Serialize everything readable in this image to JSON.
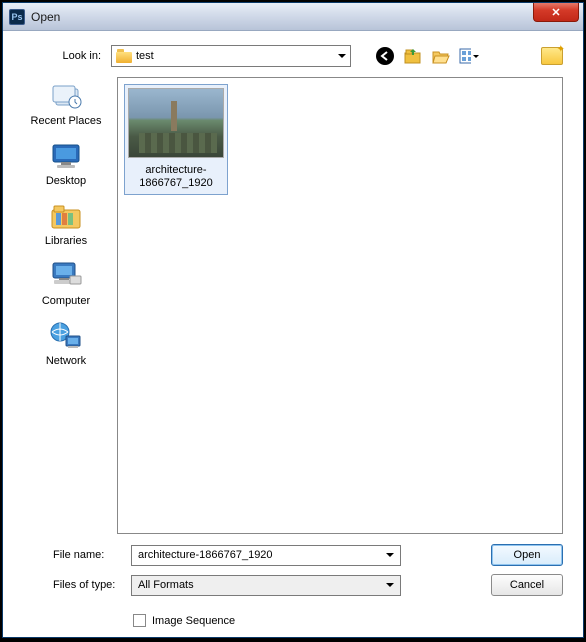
{
  "window": {
    "title": "Open",
    "close_glyph": "✕"
  },
  "lookin": {
    "label": "Look in:",
    "value": "test"
  },
  "toolbar": {
    "back": "back-icon",
    "up": "up-icon",
    "recent": "recent-icon",
    "view": "view-icon",
    "newfolder": "new-folder-icon"
  },
  "places": [
    {
      "key": "recent",
      "label": "Recent Places"
    },
    {
      "key": "desktop",
      "label": "Desktop"
    },
    {
      "key": "libraries",
      "label": "Libraries"
    },
    {
      "key": "computer",
      "label": "Computer"
    },
    {
      "key": "network",
      "label": "Network"
    }
  ],
  "files": [
    {
      "name": "architecture-1866767_1920"
    }
  ],
  "filename": {
    "label": "File name:",
    "value": "architecture-1866767_1920"
  },
  "filetype": {
    "label": "Files of type:",
    "value": "All Formats"
  },
  "buttons": {
    "open": "Open",
    "cancel": "Cancel"
  },
  "image_sequence": {
    "label": "Image Sequence",
    "checked": false
  }
}
